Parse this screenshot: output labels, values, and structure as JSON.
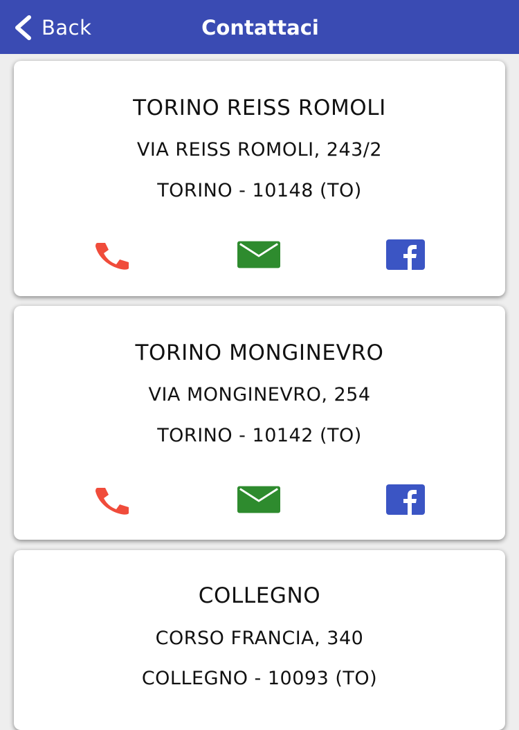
{
  "header": {
    "back_label": "Back",
    "title": "Contattaci"
  },
  "colors": {
    "nav_bar": "#3a4bb3",
    "phone_icon": "#f04c3b",
    "mail_icon": "#2e8b2e",
    "facebook_icon": "#3b55c4"
  },
  "icons": [
    "chevron-left-icon",
    "phone-icon",
    "mail-icon",
    "facebook-icon"
  ],
  "locations": [
    {
      "name": "TORINO REISS ROMOLI",
      "street": "VIA REISS ROMOLI, 243/2",
      "city": "TORINO - 10148 (TO)"
    },
    {
      "name": "TORINO MONGINEVRO",
      "street": "VIA MONGINEVRO, 254",
      "city": "TORINO - 10142 (TO)"
    },
    {
      "name": "COLLEGNO",
      "street": "CORSO FRANCIA, 340",
      "city": "COLLEGNO - 10093 (TO)"
    }
  ]
}
